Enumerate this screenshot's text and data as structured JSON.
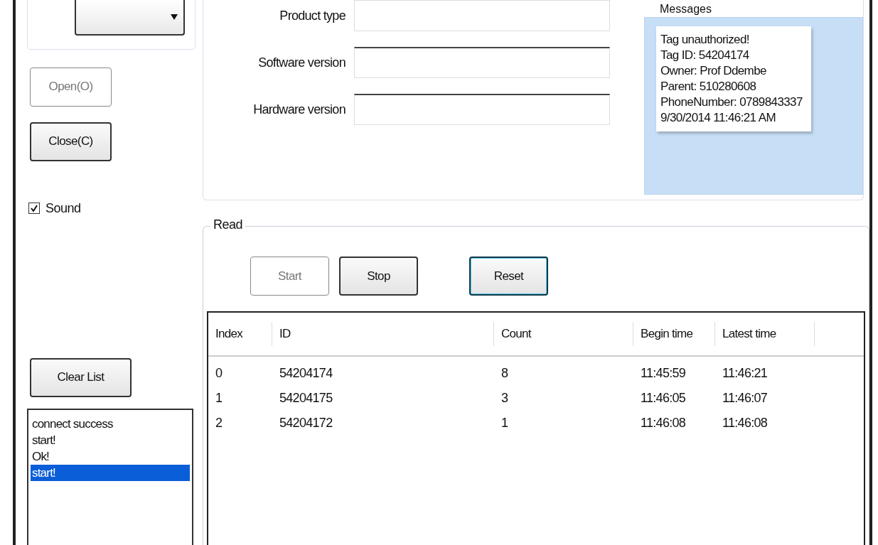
{
  "left": {
    "buttons": [
      {
        "label": "Open(O)",
        "disabled": true
      },
      {
        "label": "Close(C)",
        "disabled": false
      }
    ],
    "sound": {
      "label": "Sound",
      "checked": true
    },
    "clear_button": {
      "label": "Clear List"
    },
    "log": [
      {
        "text": "connect success",
        "selected": false
      },
      {
        "text": "start!",
        "selected": false
      },
      {
        "text": "Ok!",
        "selected": false
      },
      {
        "text": "start!",
        "selected": true
      }
    ]
  },
  "info": {
    "fields": [
      {
        "label": "Product type"
      },
      {
        "label": "Software version"
      },
      {
        "label": "Hardware version"
      }
    ],
    "messages": {
      "label": "Messages",
      "lines": [
        "Tag unauthorized!",
        "Tag ID: 54204174",
        "Owner: Prof Ddembe",
        "Parent: 510280608",
        "PhoneNumber: 0789843337",
        "9/30/2014 11:46:21 AM"
      ]
    }
  },
  "read": {
    "title": "Read",
    "buttons": [
      {
        "label": "Start",
        "disabled": true,
        "focused": false
      },
      {
        "label": "Stop",
        "disabled": false,
        "focused": false
      },
      {
        "label": "Reset",
        "disabled": false,
        "focused": true
      }
    ],
    "table": {
      "columns": [
        "Index",
        "ID",
        "Count",
        "Begin time",
        "Latest time"
      ],
      "rows": [
        [
          "0",
          "54204174",
          "8",
          "11:45:59",
          "11:46:21"
        ],
        [
          "1",
          "54204175",
          "3",
          "11:46:05",
          "11:46:07"
        ],
        [
          "2",
          "54204172",
          "1",
          "11:46:08",
          "11:46:08"
        ]
      ]
    }
  }
}
